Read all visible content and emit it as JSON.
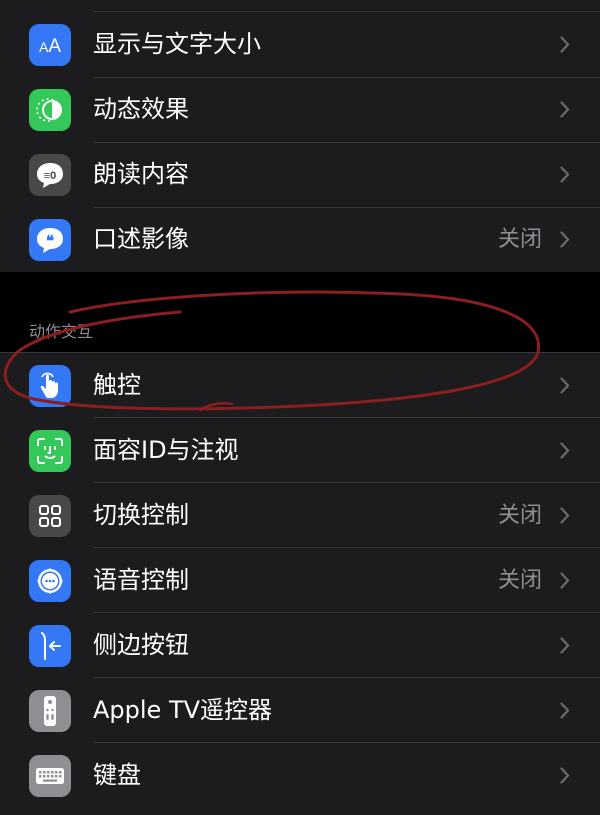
{
  "group1": {
    "items": [
      {
        "label": "显示与文字大小",
        "value": "",
        "icon": "text-size-icon",
        "color": "#3478f6"
      },
      {
        "label": "动态效果",
        "value": "",
        "icon": "motion-icon",
        "color": "#34c759"
      },
      {
        "label": "朗读内容",
        "value": "",
        "icon": "spoken-content-icon",
        "color": "#48484a"
      },
      {
        "label": "口述影像",
        "value": "关闭",
        "icon": "audio-descriptions-icon",
        "color": "#3478f6"
      }
    ]
  },
  "section_header": "动作交互",
  "group2": {
    "items": [
      {
        "label": "触控",
        "value": "",
        "icon": "touch-hand-icon",
        "color": "#3478f6"
      },
      {
        "label": "面容ID与注视",
        "value": "",
        "icon": "face-id-icon",
        "color": "#34c759"
      },
      {
        "label": "切换控制",
        "value": "关闭",
        "icon": "switch-control-icon",
        "color": "#48484a"
      },
      {
        "label": "语音控制",
        "value": "关闭",
        "icon": "voice-control-icon",
        "color": "#3478f6"
      },
      {
        "label": "侧边按钮",
        "value": "",
        "icon": "side-button-icon",
        "color": "#3478f6"
      },
      {
        "label": "Apple TV遥控器",
        "value": "",
        "icon": "tv-remote-icon",
        "color": "#8e8e93"
      },
      {
        "label": "键盘",
        "value": "",
        "icon": "keyboard-icon",
        "color": "#8e8e93"
      }
    ]
  },
  "annotation_color": "#8b1e1e"
}
